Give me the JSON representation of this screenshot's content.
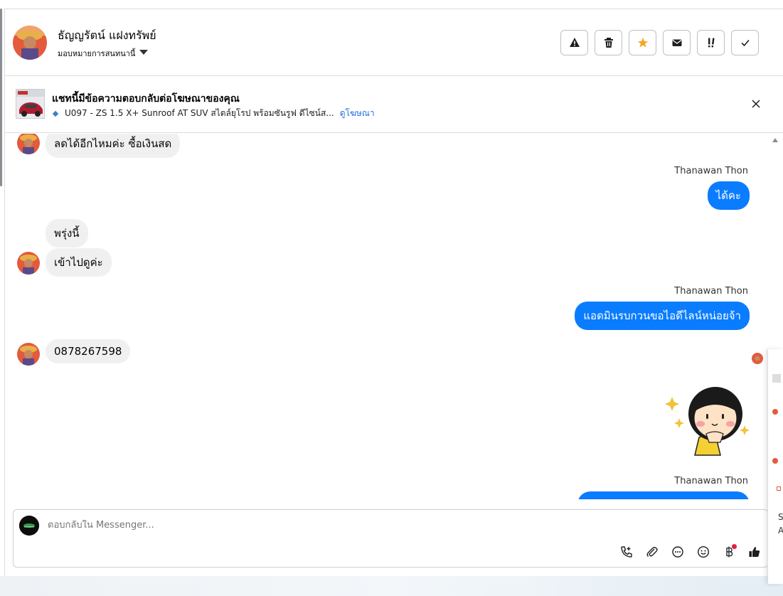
{
  "header": {
    "contact_name": "ธัญญรัตน์ แฝงทรัพย์",
    "assign_label": "มอบหมายการสนทนานี้",
    "actions": [
      {
        "name": "report-spam-button",
        "icon": "warning-icon"
      },
      {
        "name": "delete-button",
        "icon": "trash-icon"
      },
      {
        "name": "star-button",
        "icon": "star-icon"
      },
      {
        "name": "mark-unread-button",
        "icon": "envelope-icon"
      },
      {
        "name": "follow-up-button",
        "icon": "priority-icon"
      },
      {
        "name": "mark-done-button",
        "icon": "check-icon"
      }
    ]
  },
  "ad": {
    "title": "แชทนี้มีข้อความตอบกลับต่อโฆษณาของคุณ",
    "description": "U097 - ZS 1.5 X+ Sunroof AT SUV สไตล์ยุโรป พร้อมซันรูฟ ดีไซน์ส...",
    "link": "ดูโฆษณา"
  },
  "messages": {
    "m1": "ลดได้อีกไหมค่ะ ซื้อเงินสด",
    "sender1": "Thanawan Thon",
    "m2": "ได้คะ",
    "m3": "พรุ่งนี้",
    "m4": "เข้าไปดูค่ะ",
    "sender2": "Thanawan Thon",
    "m5": "แอดมินรบกวนขอไอดีไลน์หน่อยจ้า",
    "m6": "0878267598",
    "sender3": "Thanawan Thon"
  },
  "composer": {
    "placeholder": "ตอบกลับใน Messenger..."
  },
  "colors": {
    "outgoing": "#0a7cff",
    "incoming": "#f0f0f0",
    "star": "#f5a623",
    "link": "#216fdb"
  },
  "side_panel": {
    "text_1": "S",
    "text_2": "A"
  }
}
